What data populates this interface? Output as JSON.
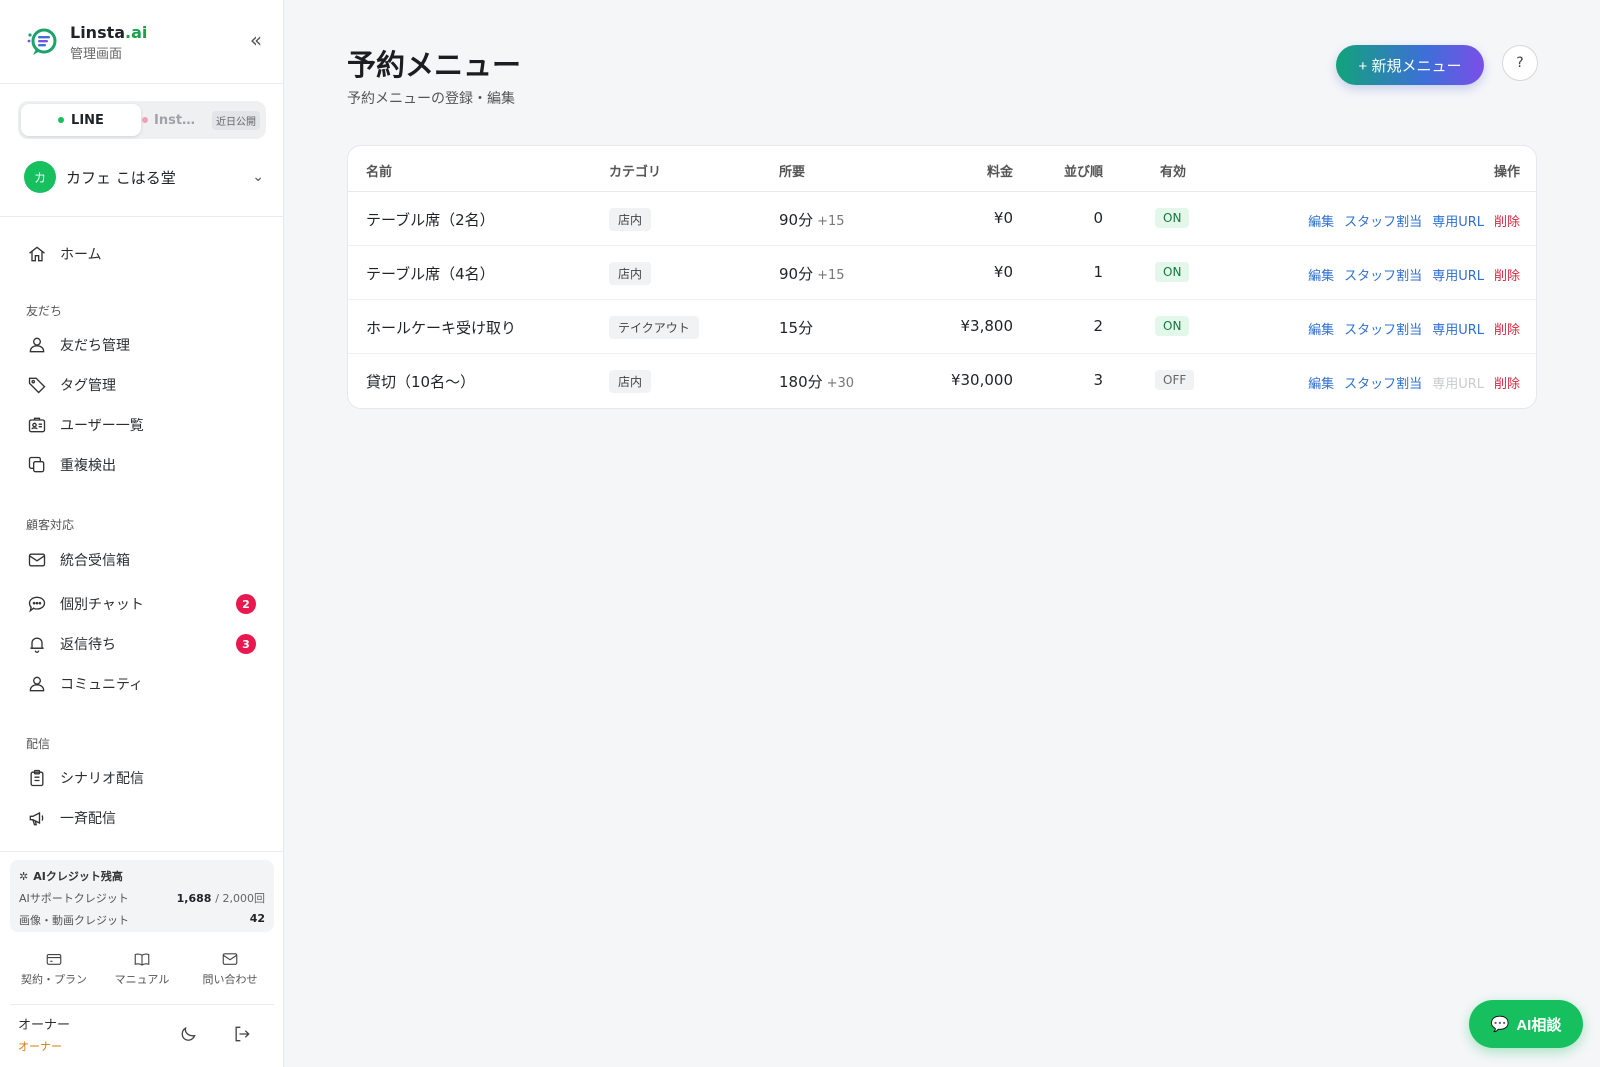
{
  "brand": {
    "name_main": "Linsta",
    "name_ai": ".ai",
    "subtitle": "管理画面",
    "collapse_glyph": "«"
  },
  "channels": {
    "line_label": "LINE",
    "insta_label": "Inst…",
    "insta_soon": "近日公開"
  },
  "account": {
    "avatar_letter": "カ",
    "name": "カフェ こはる堂",
    "chevron": "⌄"
  },
  "sidebar": {
    "items": [
      {
        "label": "ホーム",
        "icon": "home-icon"
      },
      {
        "section": "友だち"
      },
      {
        "label": "友だち管理",
        "icon": "users-icon"
      },
      {
        "label": "タグ管理",
        "icon": "tag-icon"
      },
      {
        "label": "ユーザー一覧",
        "icon": "id-card-icon"
      },
      {
        "label": "重複検出",
        "icon": "copy-icon"
      },
      {
        "section": "顧客対応"
      },
      {
        "label": "統合受信箱",
        "icon": "mail-icon"
      },
      {
        "label": "個別チャット",
        "icon": "chat-icon",
        "badge": "2"
      },
      {
        "label": "返信待ち",
        "icon": "bell-icon",
        "badge": "3"
      },
      {
        "label": "コミュニティ",
        "icon": "community-icon"
      },
      {
        "section": "配信"
      },
      {
        "label": "シナリオ配信",
        "icon": "clipboard-icon"
      },
      {
        "label": "一斉配信",
        "icon": "megaphone-icon"
      }
    ]
  },
  "credits": {
    "title": "AIクレジット残高",
    "support_label": "AIサポートクレジット",
    "support_used": "1,688",
    "support_total": "/ 2,000回",
    "media_label": "画像・動画クレジット",
    "media_value": "42"
  },
  "footer_links": {
    "plan": "契約・プラン",
    "manual": "マニュアル",
    "contact": "問い合わせ"
  },
  "user": {
    "name": "オーナー",
    "role": "オーナー"
  },
  "page": {
    "title": "予約メニュー",
    "subtitle": "予約メニューの登録・編集",
    "new_button": "+ 新規メニュー",
    "help_glyph": "?"
  },
  "table": {
    "headers": {
      "name": "名前",
      "category": "カテゴリ",
      "duration": "所要",
      "price": "料金",
      "order": "並び順",
      "enabled": "有効",
      "actions": "操作"
    },
    "action_labels": {
      "edit": "編集",
      "staff": "スタッフ割当",
      "url": "専用URL",
      "delete": "削除"
    },
    "rows": [
      {
        "name": "テーブル席（2名）",
        "category": "店内",
        "duration": "90分",
        "extra": "+15",
        "price": "¥0",
        "order": "0",
        "status": "ON"
      },
      {
        "name": "テーブル席（4名）",
        "category": "店内",
        "duration": "90分",
        "extra": "+15",
        "price": "¥0",
        "order": "1",
        "status": "ON"
      },
      {
        "name": "ホールケーキ受け取り",
        "category": "テイクアウト",
        "duration": "15分",
        "extra": "",
        "price": "¥3,800",
        "order": "2",
        "status": "ON"
      },
      {
        "name": "貸切（10名〜）",
        "category": "店内",
        "duration": "180分",
        "extra": "+30",
        "price": "¥30,000",
        "order": "3",
        "status": "OFF"
      }
    ]
  },
  "ai_button": {
    "label": "AI相談",
    "icon": "chat-bubble-icon"
  },
  "colors": {
    "accent_green": "#16c05f",
    "badge_red": "#e8194f",
    "link_blue": "#2f6fd0",
    "delete_red": "#d9283f"
  }
}
